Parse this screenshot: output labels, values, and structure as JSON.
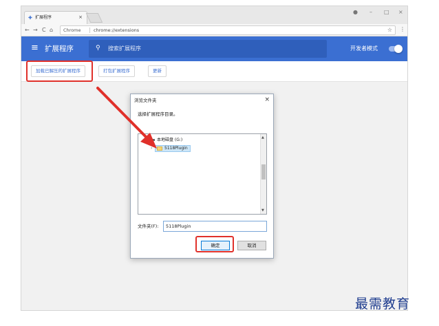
{
  "browser": {
    "tab_title": "扩展程序",
    "tab_close": "×",
    "omnibox_security": "Chrome",
    "omnibox_url": "chrome://extensions",
    "back": "←",
    "forward": "→",
    "reload": "C",
    "home": "⌂",
    "star": "☆",
    "menu": "⋮",
    "win_profile": "●",
    "win_min": "–",
    "win_max": "□",
    "win_close": "×"
  },
  "appbar": {
    "title": "扩展程序",
    "search_placeholder": "搜索扩展程序",
    "dev_mode_label": "开发者模式",
    "dev_mode_on": true
  },
  "subbar": {
    "load_unpacked": "加载已解压的扩展程序",
    "pack": "打包扩展程序",
    "update": "更新"
  },
  "dialog": {
    "title": "浏览文件夹",
    "close": "×",
    "prompt": "选择扩展程序目录。",
    "tree": {
      "drive": "本地磁盘 (G:)",
      "folder": "5118Plugin"
    },
    "folder_label": "文件夹(F):",
    "folder_value": "5118Plugin",
    "ok": "确定",
    "cancel": "取消"
  },
  "watermark": "最需教育",
  "colors": {
    "appbar": "#3b6fd2",
    "highlight": "#e0302a",
    "watermark": "#1f3d8f"
  }
}
